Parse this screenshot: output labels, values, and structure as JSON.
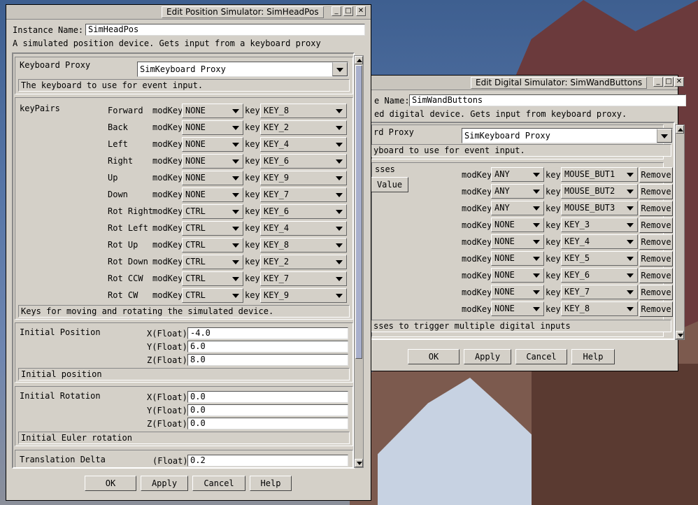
{
  "colors": {
    "window_bg": "#d4d0c8",
    "field_bg": "#ffffff",
    "desktop": "#4a6a9c"
  },
  "icons": {
    "minimize": "minimize-icon",
    "maximize": "maximize-icon",
    "close": "close-icon"
  },
  "window1": {
    "title": "Edit Position Simulator: SimHeadPos",
    "instance_label": "Instance Name:",
    "instance_value": "SimHeadPos",
    "description": "A simulated position device. Gets input from a keyboard proxy",
    "keyboard_proxy": {
      "label": "Keyboard Proxy",
      "value": "SimKeyboard Proxy",
      "desc": "The keyboard to use for event input."
    },
    "keypairs": {
      "label": "keyPairs",
      "mod_label": "modKey",
      "key_label": "key",
      "rows": [
        {
          "name": "Forward",
          "mod": "NONE",
          "key": "KEY_8"
        },
        {
          "name": "Back",
          "mod": "NONE",
          "key": "KEY_2"
        },
        {
          "name": "Left",
          "mod": "NONE",
          "key": "KEY_4"
        },
        {
          "name": "Right",
          "mod": "NONE",
          "key": "KEY_6"
        },
        {
          "name": "Up",
          "mod": "NONE",
          "key": "KEY_9"
        },
        {
          "name": "Down",
          "mod": "NONE",
          "key": "KEY_7"
        },
        {
          "name": "Rot Right",
          "mod": "CTRL",
          "key": "KEY_6"
        },
        {
          "name": "Rot Left",
          "mod": "CTRL",
          "key": "KEY_4"
        },
        {
          "name": "Rot Up",
          "mod": "CTRL",
          "key": "KEY_8"
        },
        {
          "name": "Rot Down",
          "mod": "CTRL",
          "key": "KEY_2"
        },
        {
          "name": "Rot CCW",
          "mod": "CTRL",
          "key": "KEY_7"
        },
        {
          "name": "Rot CW",
          "mod": "CTRL",
          "key": "KEY_9"
        }
      ],
      "desc": "Keys for moving and rotating the simulated device."
    },
    "initial_position": {
      "label": "Initial Position",
      "x_label": "X(Float)",
      "x": "-4.0",
      "y_label": "Y(Float)",
      "y": "6.0",
      "z_label": "Z(Float)",
      "z": "8.0",
      "desc": "Initial position"
    },
    "initial_rotation": {
      "label": "Initial Rotation",
      "x_label": "X(Float)",
      "x": "0.0",
      "y_label": "Y(Float)",
      "y": "0.0",
      "z_label": "Z(Float)",
      "z": "0.0",
      "desc": "Initial Euler rotation"
    },
    "translation_delta": {
      "label": "Translation Delta",
      "float_label": "(Float)",
      "value": "0.2"
    },
    "buttons": {
      "ok": "OK",
      "apply": "Apply",
      "cancel": "Cancel",
      "help": "Help"
    }
  },
  "window2": {
    "title": "Edit Digital Simulator: SimWandButtons",
    "instance_label": "e Name:",
    "instance_value": "SimWandButtons",
    "description": "ed digital device.  Gets input from keyboard proxy.",
    "keyboard_proxy": {
      "label": "rd Proxy",
      "value": "SimKeyboard Proxy",
      "desc": "yboard to use for event input."
    },
    "presses": {
      "label": "sses",
      "add_value": "Value",
      "mod_label": "modKey",
      "key_label": "key",
      "remove_label": "Remove",
      "rows": [
        {
          "mod": "ANY",
          "key": "MOUSE_BUT1"
        },
        {
          "mod": "ANY",
          "key": "MOUSE_BUT2"
        },
        {
          "mod": "ANY",
          "key": "MOUSE_BUT3"
        },
        {
          "mod": "NONE",
          "key": "KEY_3"
        },
        {
          "mod": "NONE",
          "key": "KEY_4"
        },
        {
          "mod": "NONE",
          "key": "KEY_5"
        },
        {
          "mod": "NONE",
          "key": "KEY_6"
        },
        {
          "mod": "NONE",
          "key": "KEY_7"
        },
        {
          "mod": "NONE",
          "key": "KEY_8"
        }
      ],
      "desc": "sses to trigger multiple digital inputs"
    },
    "buttons": {
      "ok": "OK",
      "apply": "Apply",
      "cancel": "Cancel",
      "help": "Help"
    }
  }
}
